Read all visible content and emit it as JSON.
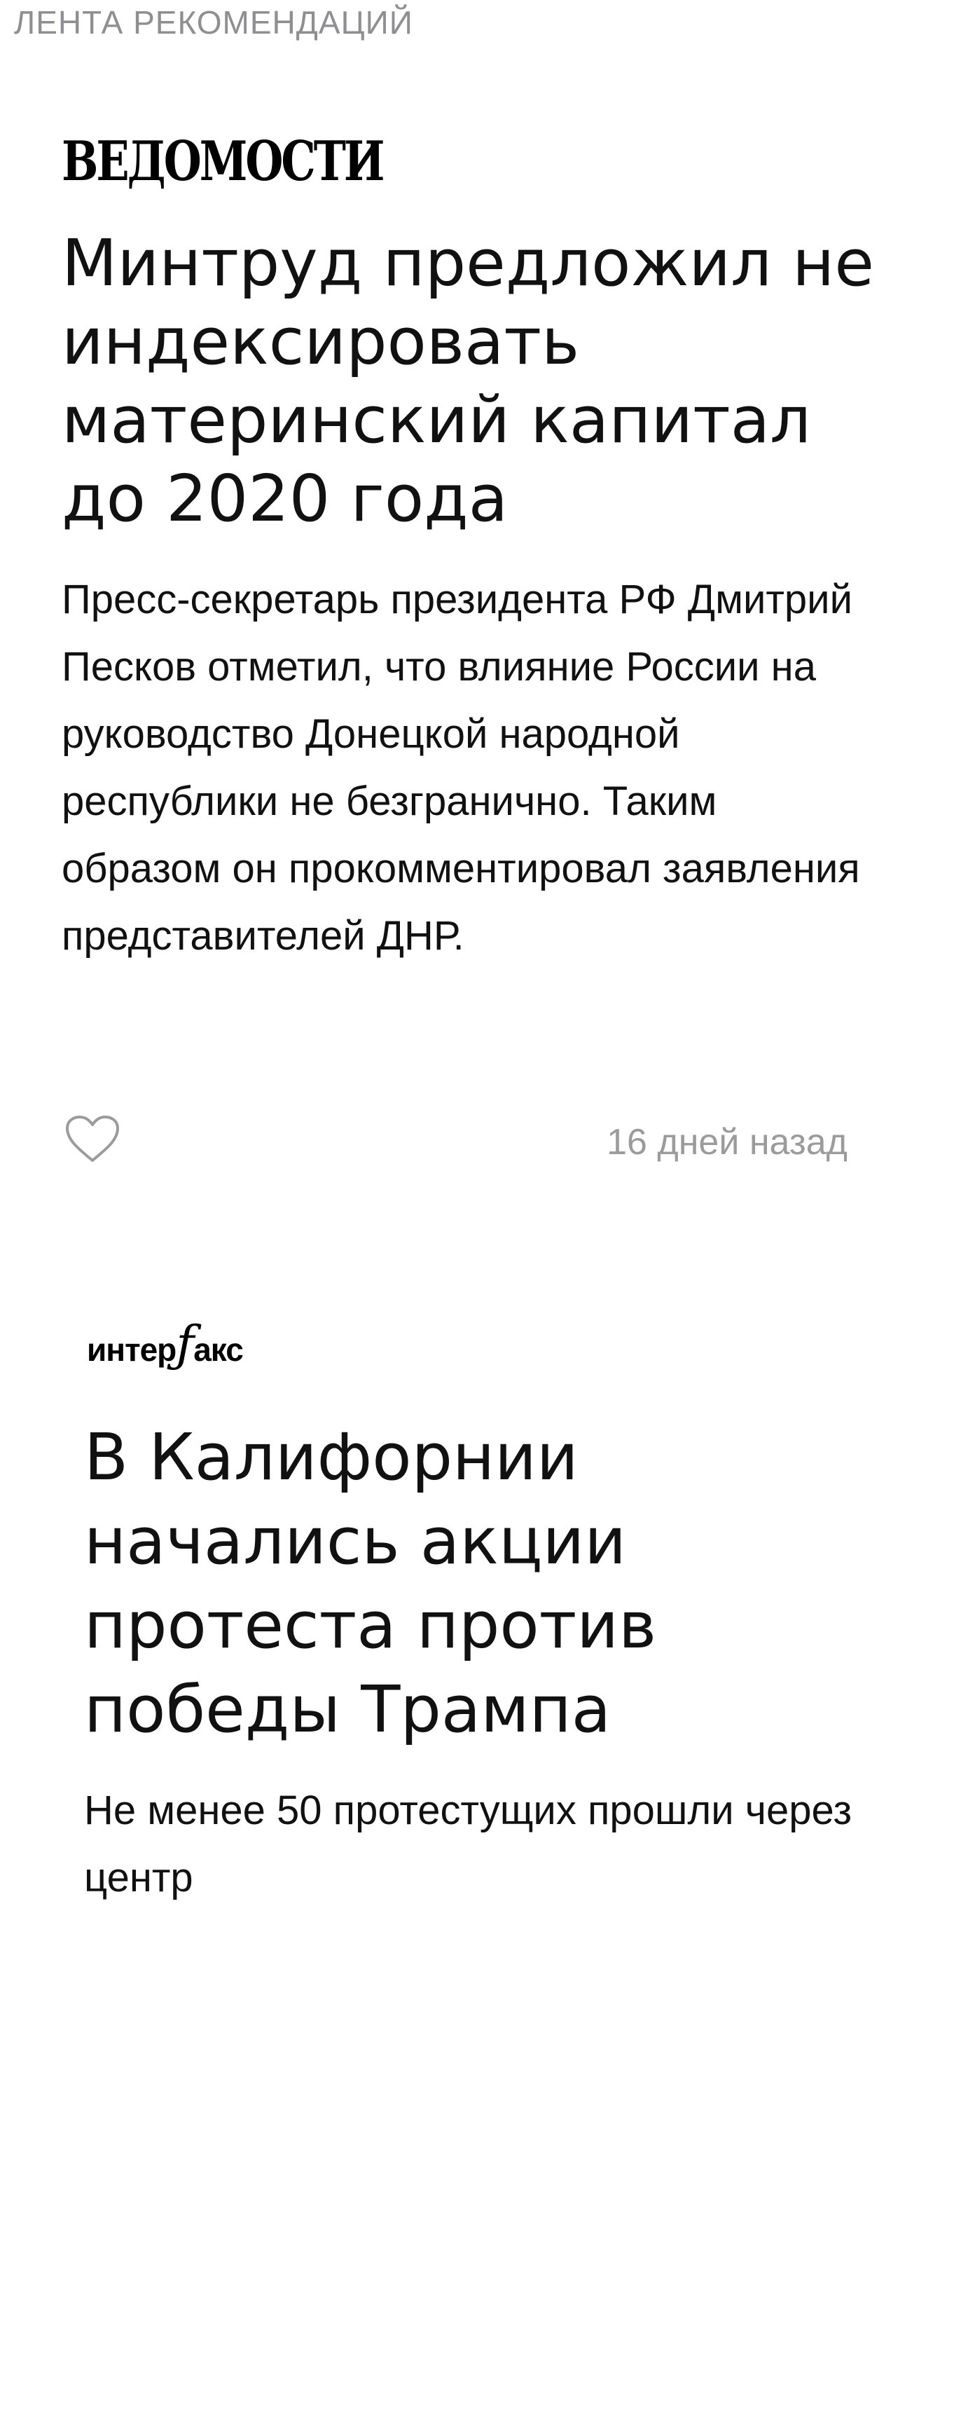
{
  "section_header": "ЛЕНТА РЕКОМЕНДАЦИЙ",
  "articles": [
    {
      "source": "ВЕДОМОСТИ",
      "title": "Минтруд предложил не индексировать материнский капитал до 2020 года",
      "lead": "Пресс-секретарь президента РФ Дмитрий Песков отметил, что влияние России на руководство Донецкой народной республики не безгранично. Таким образом он прокомментировал заявления представителей ДНР.",
      "like_icon": "heart-outline-icon",
      "timestamp": "16 дней назад"
    },
    {
      "source_part1": "интер",
      "source_part2": "ƒ",
      "source_part3": "акс",
      "title": "В Калифорнии начались акции протеста против победы Трампа",
      "lead": "Не менее 50 протестущих прошли через центр"
    }
  ],
  "colors": {
    "text": "#111111",
    "muted": "#9b9b9b",
    "header": "#8e8e93",
    "icon_stroke": "#9b9b9b"
  }
}
